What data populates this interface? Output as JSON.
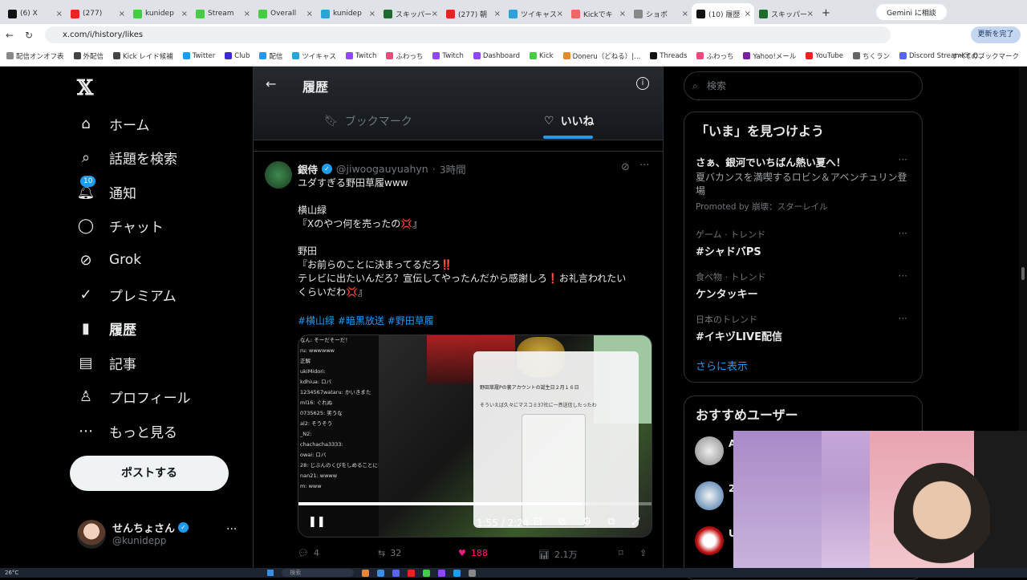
{
  "browser": {
    "tabs": [
      {
        "title": "(6) X",
        "color": "#111"
      },
      {
        "title": "(277)",
        "color": "#e22"
      },
      {
        "title": "kunidep",
        "color": "#44cc44"
      },
      {
        "title": "Stream",
        "color": "#44cc44"
      },
      {
        "title": "Overall",
        "color": "#44cc44"
      },
      {
        "title": "kunidep",
        "color": "#29a3d8"
      },
      {
        "title": "スキッパー",
        "color": "#1e6b2e"
      },
      {
        "title": "(277) 朝",
        "color": "#e22"
      },
      {
        "title": "ツイキャス",
        "color": "#29a3d8"
      },
      {
        "title": "Kickでキ",
        "color": "#e66"
      },
      {
        "title": "ショボ",
        "color": "#888"
      },
      {
        "title": "(10) 履歴",
        "color": "#111"
      },
      {
        "title": "スキッパー",
        "color": "#1e6b2e"
      }
    ],
    "active_tab_index": 11,
    "gemini_label": "Gemini に相談",
    "url": "x.com/i/history/likes",
    "update_label": "更新を完了",
    "bookmarks": [
      {
        "label": "配信オンオフ表",
        "color": "#888"
      },
      {
        "label": "外配信",
        "color": "#444"
      },
      {
        "label": "Kick レイド候補",
        "color": "#444"
      },
      {
        "label": "Twitter",
        "color": "#1d9bf0"
      },
      {
        "label": "Club",
        "color": "#3b2bd0"
      },
      {
        "label": "配信",
        "color": "#1d9bf0"
      },
      {
        "label": "ツイキャス",
        "color": "#29a3d8"
      },
      {
        "label": "Twitch",
        "color": "#9146ff"
      },
      {
        "label": "ふわっち",
        "color": "#e94b7a"
      },
      {
        "label": "Twitch",
        "color": "#9146ff"
      },
      {
        "label": "Dashboard",
        "color": "#9146ff"
      },
      {
        "label": "Kick",
        "color": "#44cc44"
      },
      {
        "label": "Doneru（どねる）|...",
        "color": "#e48a2a"
      },
      {
        "label": "Threads",
        "color": "#111"
      },
      {
        "label": "ふわっち",
        "color": "#e94b7a"
      },
      {
        "label": "Yahoo!メール",
        "color": "#7b1fa2"
      },
      {
        "label": "YouTube",
        "color": "#e22"
      },
      {
        "label": "ちくラン",
        "color": "#666"
      },
      {
        "label": "Discord StreamKit O...",
        "color": "#5865f2"
      }
    ],
    "all_bookmarks": "すべてのブックマーク"
  },
  "nav": {
    "items": [
      {
        "label": "ホーム",
        "icon": "home-icon"
      },
      {
        "label": "話題を検索",
        "icon": "search-icon"
      },
      {
        "label": "通知",
        "icon": "bell-icon",
        "badge": "10"
      },
      {
        "label": "チャット",
        "icon": "chat-icon"
      },
      {
        "label": "Grok",
        "icon": "grok-icon"
      },
      {
        "label": "プレミアム",
        "icon": "verified-icon"
      },
      {
        "label": "履歴",
        "icon": "bookmark-icon"
      },
      {
        "label": "記事",
        "icon": "article-icon"
      },
      {
        "label": "プロフィール",
        "icon": "profile-icon"
      },
      {
        "label": "もっと見る",
        "icon": "more-circle-icon"
      }
    ],
    "post_button": "ポストする",
    "account": {
      "name": "せんちょさん",
      "handle": "@kunidepp"
    }
  },
  "header": {
    "title": "履歴",
    "tabs": [
      {
        "label": "ブックマーク",
        "active": false
      },
      {
        "label": "いいね",
        "active": true
      }
    ]
  },
  "tweet": {
    "author": "銀侍",
    "handle": "@jiwoogauyuahyn",
    "time": "3時間",
    "lines": [
      "ユダすぎる野田草履www",
      "",
      "横山緑",
      "『Xのやつ何を売ったの💢』",
      "",
      "野田",
      "『お前らのことに決まってるだろ‼️",
      "テレビに出たいんだろ？宣伝してやったんだから感謝しろ❗お礼言われたい",
      "くらいだわ💢』"
    ],
    "hashtags": "#横山緑 #暗黒放送 #野田草履",
    "video_time": "1:55 / 2:24",
    "video_progress": 0.8,
    "video_chat": [
      "なん: そーだそーだ！",
      "ru: wwwwww",
      "正解",
      "ukiMidori:",
      "kdhiua: ロバ",
      "1234567wataru: かいきまた",
      "ml16: ぐれぬ",
      "0735625: 笑うな",
      "al2: そうそう",
      "_N2:",
      "chachacha3333:",
      "owai: ロバ",
      "28: じぶんのくびをしめることにな",
      "nan21: wwww",
      "m: www"
    ],
    "video_overlay_header": "野田草履Pの裏アカウントの誕生日２月１６日",
    "video_overlay_text": "そういえば久々にマスコミ37社に一斉送信したったわ",
    "replies": "4",
    "reposts": "32",
    "likes": "188",
    "views": "2.1万"
  },
  "right": {
    "search_placeholder": "検索",
    "trends_title": "「いま」を見つけよう",
    "trends": [
      {
        "context": "",
        "title": "さぁ、銀河でいちばん熱い夏へ！",
        "desc": "夏バカンスを満喫するロビン＆アベンチュリン登場",
        "promo": "Promoted by 崩壊：スターレイル"
      },
      {
        "context": "ゲーム · トレンド",
        "title": "#シャドバPS"
      },
      {
        "context": "食べ物 · トレンド",
        "title": "ケンタッキー"
      },
      {
        "context": "日本のトレンド",
        "title": "#イキヅLIVE配信"
      }
    ],
    "show_more": "さらに表示",
    "rec_title": "おすすめユーザー",
    "rec_users": [
      {
        "initial": "A"
      },
      {
        "initial": "2"
      },
      {
        "initial": "U"
      }
    ]
  },
  "taskbar": {
    "weather": "26°C",
    "search": "検索"
  }
}
